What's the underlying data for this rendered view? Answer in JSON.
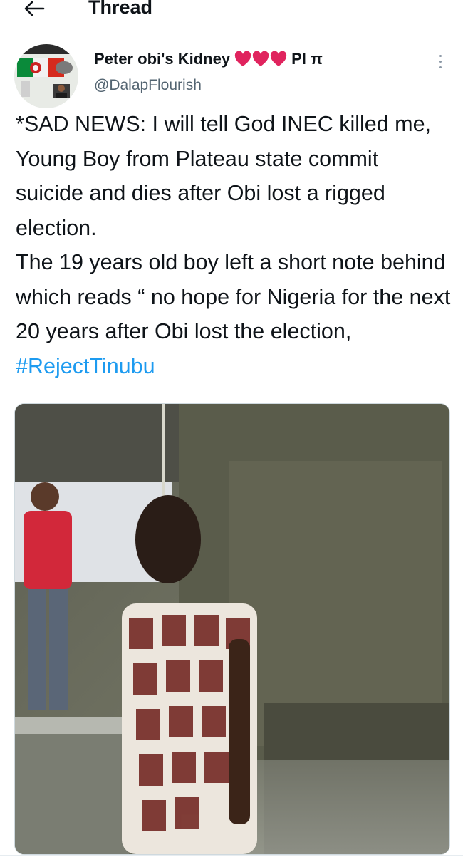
{
  "header": {
    "title": "Thread"
  },
  "tweet": {
    "author_name": "Peter obi's Kidney",
    "author_suffix": "PI π",
    "handle": "@DalapFlourish",
    "text_main": "*SAD NEWS: I will tell God INEC killed me, Young Boy from Plateau state commit suicide and dies after Obi lost a rigged election.\nThe 19 years old boy left a short note behind which reads “ no hope for Nigeria for the next 20 years after Obi lost the election,  ",
    "hashtag": "#RejectTinubu",
    "media_icon": "photo",
    "heart_color": "#e0245e"
  },
  "icons": {
    "back": "arrow-left-icon",
    "more": "more-vertical-icon",
    "hearts": [
      "red-heart-icon",
      "red-heart-icon",
      "red-heart-icon"
    ]
  }
}
